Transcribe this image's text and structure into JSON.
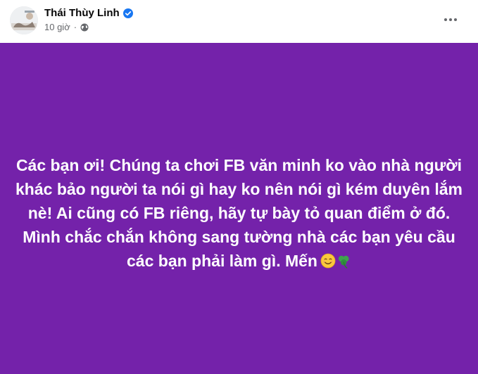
{
  "post": {
    "author_name": "Thái Thùy Linh",
    "timestamp": "10 giờ",
    "separator": "·",
    "verified": true,
    "audience_icon": "globe-icon",
    "more_icon": "more-horizontal-icon",
    "text": "Các bạn ơi! Chúng ta chơi FB văn minh ko vào nhà người khác bảo người ta nói gì hay ko nên nói gì kém duyên lắm nè! Ai cũng có FB riêng, hãy tự bày tỏ quan điểm ở đó. Mình chắc chắn không sang tường nhà các bạn yêu cầu các bạn phải làm gì. Mến",
    "emojis": [
      "smiling-face-icon",
      "shamrock-icon"
    ],
    "background_color": "#7422aa",
    "text_color": "#ffffff"
  },
  "colors": {
    "verified_blue": "#1877f2",
    "secondary_text": "#65676b"
  }
}
